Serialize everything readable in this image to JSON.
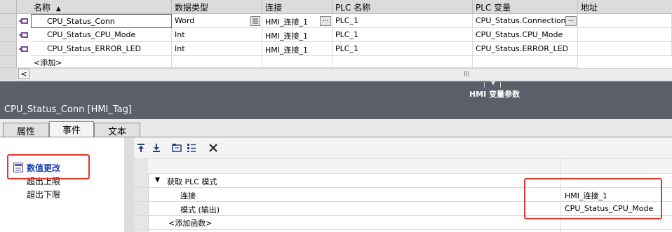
{
  "table": {
    "headers": {
      "name": "名称",
      "datatype": "数据类型",
      "connection": "连接",
      "plc_name": "PLC 名称",
      "plc_var": "PLC 变量",
      "address": "地址"
    },
    "rows": [
      {
        "name": "CPU_Status_Conn",
        "datatype": "Word",
        "connection": "HMI_连接_1",
        "plc_name": "PLC_1",
        "plc_var": "CPU_Status.Connection"
      },
      {
        "name": "CPU_Status_CPU_Mode",
        "datatype": "Int",
        "connection": "HMI_连接_1",
        "plc_name": "PLC_1",
        "plc_var": "CPU_Status.CPU_Mode"
      },
      {
        "name": "CPU_Status_ERROR_LED",
        "datatype": "Int",
        "connection": "HMI_连接_1",
        "plc_name": "PLC_1",
        "plc_var": "CPU_Status.ERROR_LED"
      }
    ],
    "add_row": "<添加>",
    "scroll_left": "<",
    "scroll_thumb": "|||",
    "ellipsis": "..."
  },
  "banner_title": "HMI 变量参数",
  "properties": {
    "title": "CPU_Status_Conn [HMI_Tag]",
    "tabs": [
      "属性",
      "事件",
      "文本"
    ],
    "events": [
      "数值更改",
      "超出上限",
      "超出下限"
    ],
    "function_list": {
      "group": "获取 PLC 模式",
      "params": [
        {
          "name": "连接",
          "value": "HMI_连接_1"
        },
        {
          "name": "模式 (输出)",
          "value": "CPU_Status_CPU_Mode"
        }
      ],
      "add_function": "<添加函数>"
    }
  },
  "colors": {
    "highlight": "#e8322a",
    "banner": "#5a5f69",
    "event_active": "#1a3fb0"
  }
}
